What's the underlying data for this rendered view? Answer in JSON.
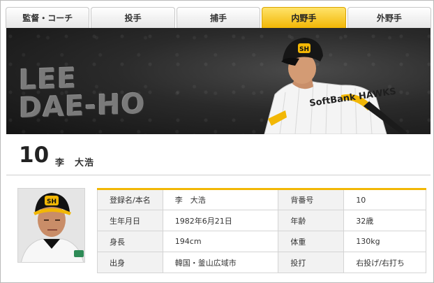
{
  "tabs": [
    {
      "label": "監督・コーチ",
      "active": false
    },
    {
      "label": "投手",
      "active": false
    },
    {
      "label": "捕手",
      "active": false
    },
    {
      "label": "内野手",
      "active": true
    },
    {
      "label": "外野手",
      "active": false
    }
  ],
  "banner": {
    "name_line1": "LEE",
    "name_line2": "DAE-HO",
    "cap_logo": "SH",
    "jersey_text": "SoftBank HAWKS"
  },
  "player": {
    "number": "10",
    "name": "李　大浩"
  },
  "profile": {
    "rows": [
      {
        "label": "登録名/本名",
        "value": "李　大浩",
        "label2": "背番号",
        "value2": "10"
      },
      {
        "label": "生年月日",
        "value": "1982年6月21日",
        "label2": "年齢",
        "value2": "32歳"
      },
      {
        "label": "身長",
        "value": "194cm",
        "label2": "体重",
        "value2": "130kg"
      },
      {
        "label": "出身",
        "value": "韓国・釜山広域市",
        "label2": "投打",
        "value2": "右投げ/右打ち"
      }
    ]
  },
  "colors": {
    "accent": "#f2b705",
    "banner_bg": "#2a2a2a",
    "label_bg": "#f2f2f2"
  }
}
